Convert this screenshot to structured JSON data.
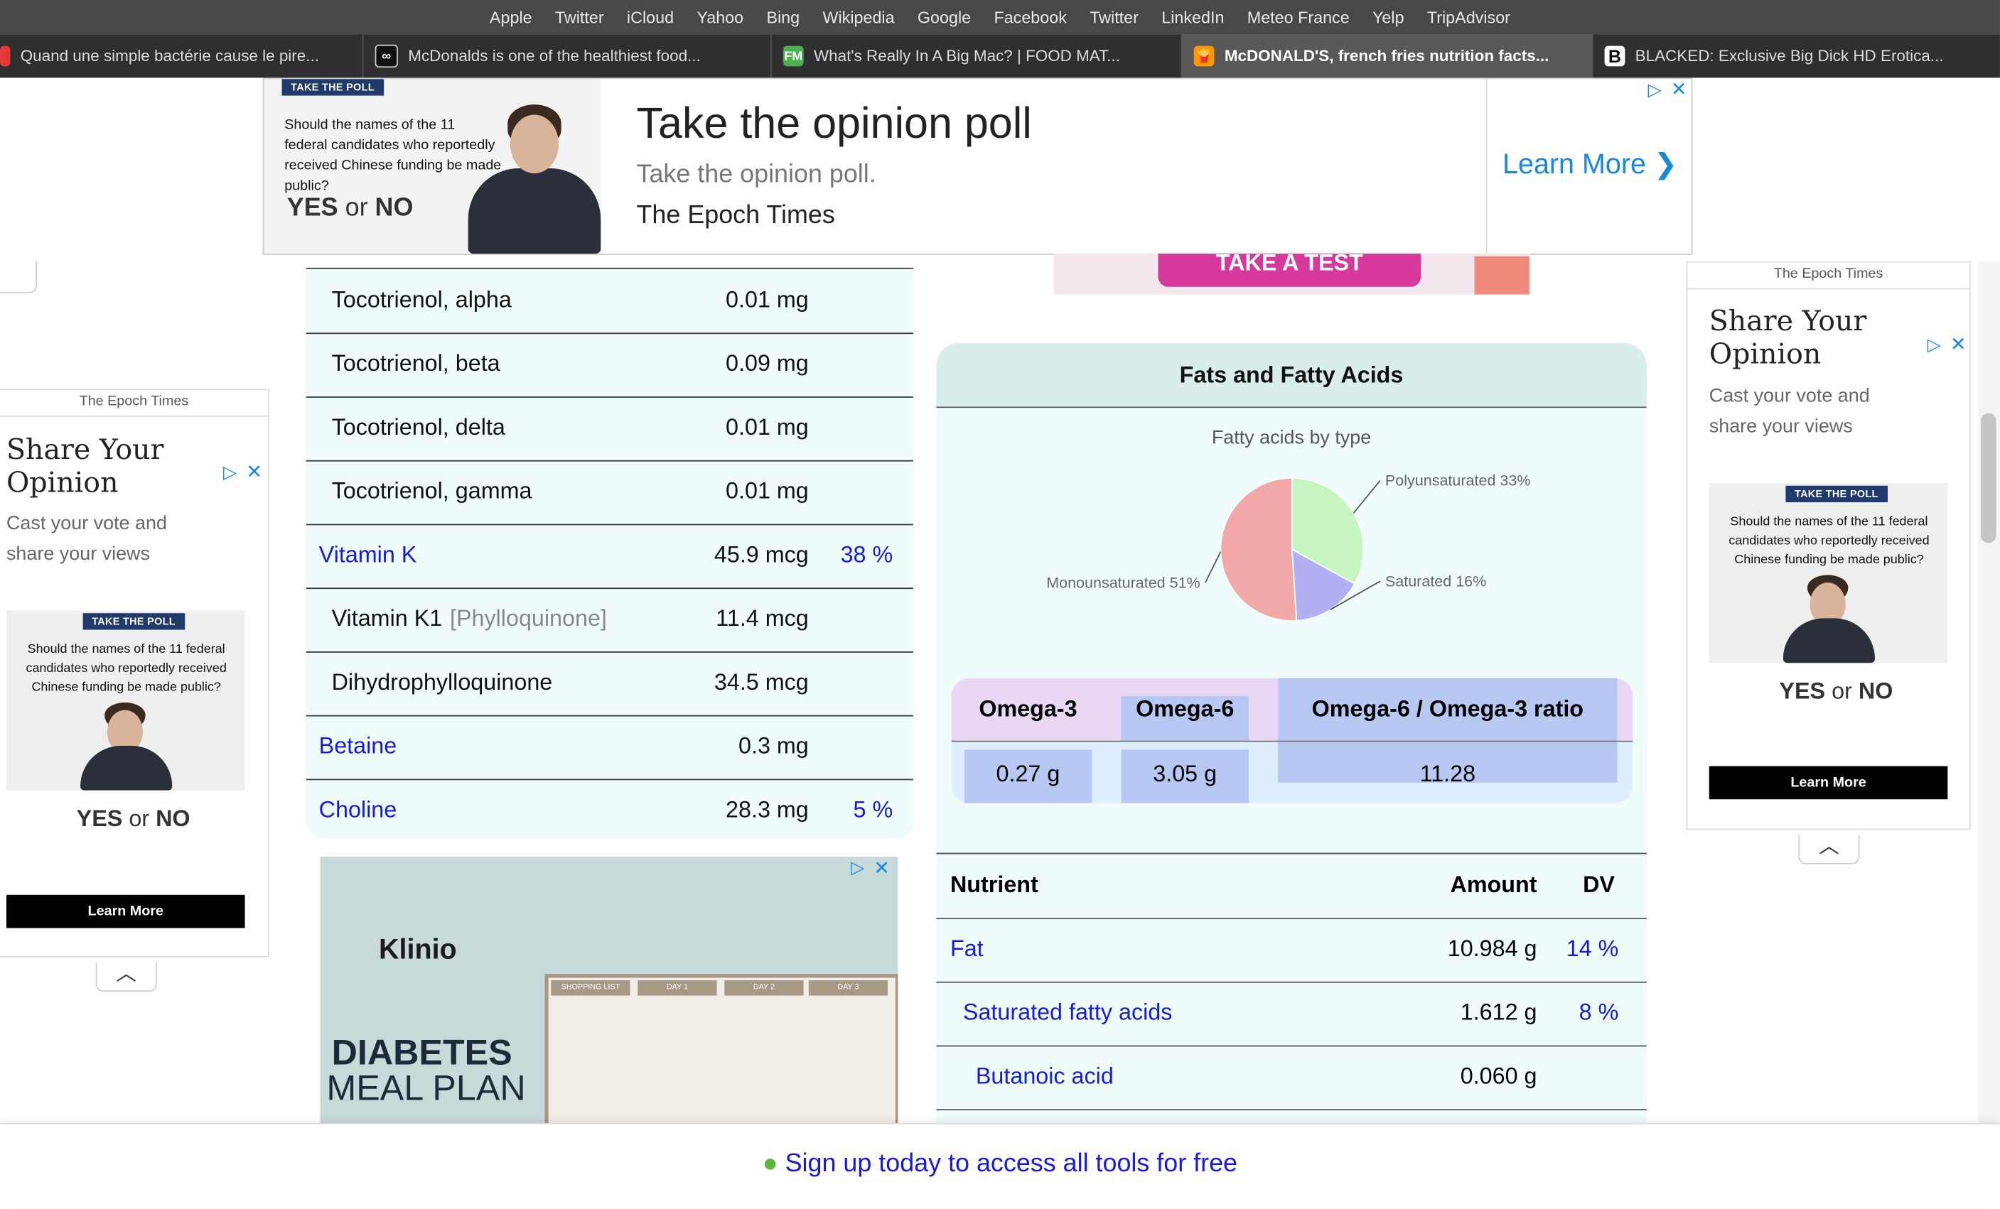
{
  "bookmarks": [
    "Apple",
    "Twitter",
    "iCloud",
    "Yahoo",
    "Bing",
    "Wikipedia",
    "Google",
    "Facebook",
    "Twitter",
    "LinkedIn",
    "Meteo France",
    "Yelp",
    "TripAdvisor"
  ],
  "tabs": [
    {
      "title": "Quand une simple bactérie cause le pire...",
      "icon": "youtube-icon",
      "color": "#e53935"
    },
    {
      "title": "McDonalds is one of the healthiest food...",
      "icon": "infinity-icon",
      "color": "#222222"
    },
    {
      "title": "What's Really In A Big Mac? | FOOD MAT...",
      "icon": "fm-icon",
      "color": "#4caf50",
      "badge": "FM"
    },
    {
      "title": "McDONALD'S, french fries nutrition facts...",
      "icon": "fries-icon",
      "color": "#ff9800"
    },
    {
      "title": "BLACKED: Exclusive Big Dick HD Erotica...",
      "icon": "b-icon",
      "color": "#111111",
      "badge": "B"
    }
  ],
  "top_ad": {
    "poll_header": "TAKE THE POLL",
    "poll_question": "Should the names of the 11 federal candidates who reportedly received Chinese funding be made public?",
    "yes": "YES",
    "or": "or",
    "no": "NO",
    "headline": "Take the opinion poll",
    "sub": "Take the opinion poll.",
    "source": "The Epoch Times",
    "cta": "Learn More",
    "partial_banner": "TAKE A TEST"
  },
  "left_rows": [
    {
      "name": "Tocotrienol, alpha",
      "amount": "0.01 mg",
      "dv": "",
      "link": false,
      "indent": true
    },
    {
      "name": "Tocotrienol, beta",
      "amount": "0.09 mg",
      "dv": "",
      "link": false,
      "indent": true
    },
    {
      "name": "Tocotrienol, delta",
      "amount": "0.01 mg",
      "dv": "",
      "link": false,
      "indent": true
    },
    {
      "name": "Tocotrienol, gamma",
      "amount": "0.01 mg",
      "dv": "",
      "link": false,
      "indent": true
    },
    {
      "name": "Vitamin K",
      "amount": "45.9 mcg",
      "dv": "38 %",
      "link": true,
      "indent": false
    },
    {
      "name": "Vitamin K1",
      "extra": "[Phylloquinone]",
      "amount": "11.4 mcg",
      "dv": "",
      "link": false,
      "indent": true
    },
    {
      "name": "Dihydrophylloquinone",
      "amount": "34.5 mcg",
      "dv": "",
      "link": false,
      "indent": true
    },
    {
      "name": "Betaine",
      "amount": "0.3 mg",
      "dv": "",
      "link": true,
      "indent": false
    },
    {
      "name": "Choline",
      "amount": "28.3 mg",
      "dv": "5 %",
      "link": true,
      "indent": false
    }
  ],
  "klinio_ad": {
    "brand": "Klinio",
    "title1": "DIABETES",
    "title2": "MEAL PLAN",
    "columns": [
      "SHOPPING LIST",
      "DAY 1",
      "DAY 2",
      "DAY 3"
    ]
  },
  "fats": {
    "header": "Fats and Fatty Acids",
    "chart_data": {
      "type": "pie",
      "title": "Fatty acids by type",
      "slices": [
        {
          "label": "Polyunsaturated 33%",
          "value": 33,
          "color": "#c6f5c0"
        },
        {
          "label": "Saturated 16%",
          "value": 16,
          "color": "#b0b0f2"
        },
        {
          "label": "Monounsaturated 51%",
          "value": 51,
          "color": "#f2a8a8"
        }
      ]
    },
    "omega": {
      "h1": "Omega-3",
      "h2": "Omega-6",
      "h3": "Omega-6 / Omega-3 ratio",
      "v1": "0.27 g",
      "v2": "3.05 g",
      "v3": "11.28"
    },
    "table": {
      "headers": [
        "Nutrient",
        "Amount",
        "DV"
      ],
      "rows": [
        {
          "name": "Fat",
          "amount": "10.984 g",
          "dv": "14 %",
          "level": 0
        },
        {
          "name": "Saturated fatty acids",
          "amount": "1.612 g",
          "dv": "8 %",
          "level": 1
        },
        {
          "name": "Butanoic acid",
          "amount": "0.060 g",
          "dv": "",
          "level": 2
        }
      ]
    }
  },
  "side_ad": {
    "source": "The Epoch Times",
    "title": "Share Your Opinion",
    "sub": "Cast your vote and share your views",
    "poll_header": "TAKE THE POLL",
    "poll_question": "Should the names of the 11 federal candidates who reportedly received Chinese funding be made public?",
    "yes": "YES",
    "or": "or",
    "no": "NO",
    "cta": "Learn More"
  },
  "bottom_bar": {
    "icon": "apple-icon",
    "text": "Sign up today to access all tools for free"
  },
  "colors": {
    "link": "#1a1ad6",
    "panel": "#effcfb",
    "header": "#d9eeea"
  }
}
